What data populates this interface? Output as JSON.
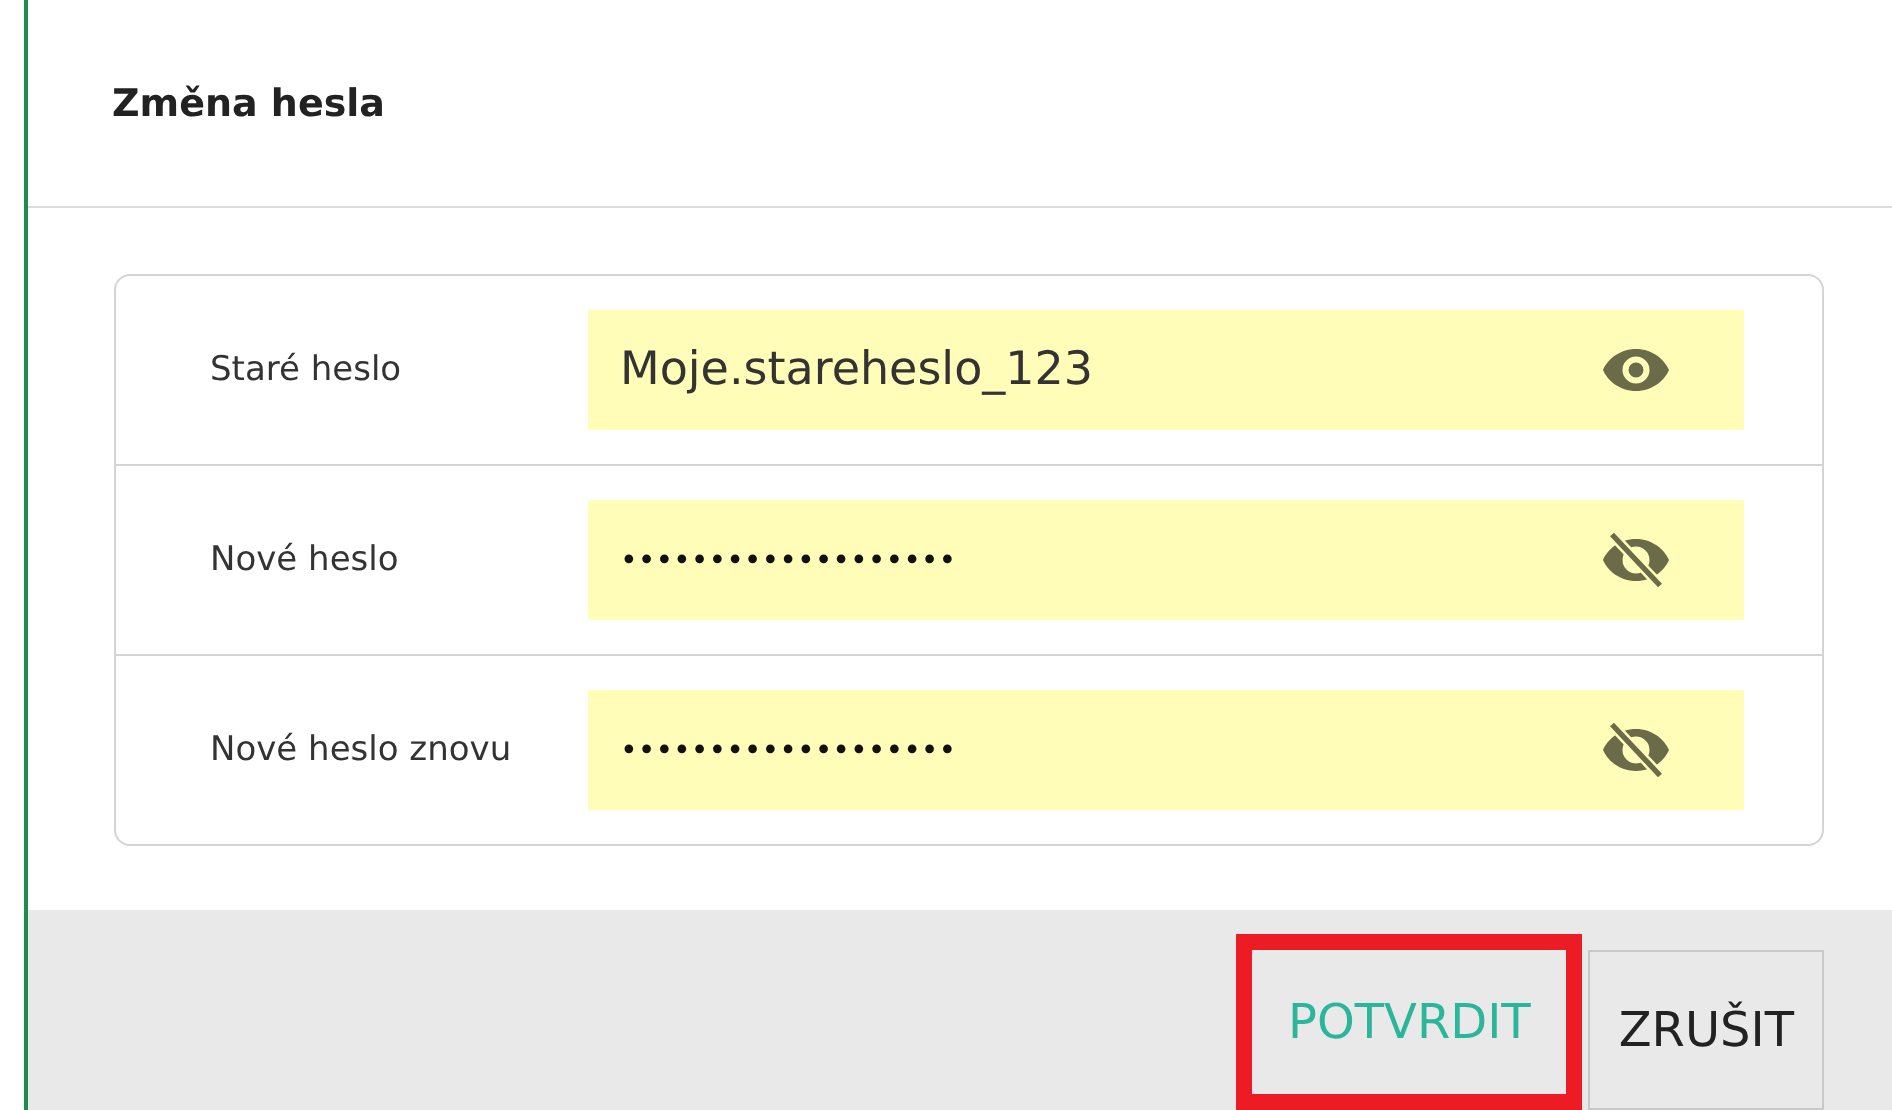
{
  "dialog": {
    "title": "Změna hesla"
  },
  "fields": [
    {
      "label": "Staré heslo",
      "value": "Moje.stareheslo_123",
      "visible": true
    },
    {
      "label": "Nové heslo",
      "value": "•••••••••••••••••••",
      "visible": false
    },
    {
      "label": "Nové heslo znovu",
      "value": "•••••••••••••••••••",
      "visible": false
    }
  ],
  "buttons": [
    {
      "label": "POTVRDIT",
      "kind": "primary",
      "highlighted": true
    },
    {
      "label": "ZRUŠIT",
      "kind": "secondary",
      "highlighted": false
    }
  ]
}
